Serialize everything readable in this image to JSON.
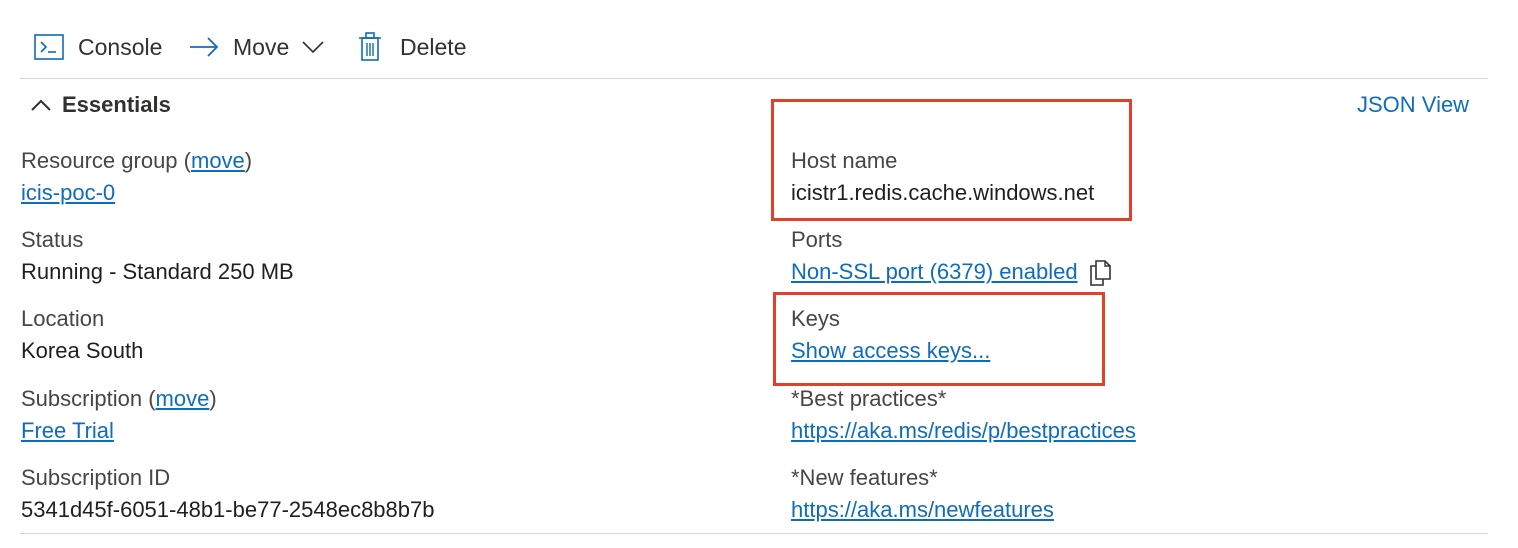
{
  "toolbar": {
    "console_label": "Console",
    "move_label": "Move",
    "delete_label": "Delete",
    "icons": {
      "console": "console-icon",
      "move": "arrow-right-icon",
      "move_dropdown": "chevron-down-icon",
      "delete": "trash-icon"
    }
  },
  "essentials": {
    "title": "Essentials",
    "json_view": "JSON View",
    "left": {
      "resource_group_label": "Resource group",
      "resource_group_move": "move",
      "resource_group_value": "icis-poc-0",
      "status_label": "Status",
      "status_value": "Running - Standard 250 MB",
      "location_label": "Location",
      "location_value": "Korea South",
      "subscription_label": "Subscription",
      "subscription_move": "move",
      "subscription_value": "Free Trial",
      "subscription_id_label": "Subscription ID",
      "subscription_id_value": "5341d45f-6051-48b1-be77-2548ec8b8b7b"
    },
    "right": {
      "host_name_label": "Host name",
      "host_name_value": "icistr1.redis.cache.windows.net",
      "ports_label": "Ports",
      "ports_value": "Non-SSL port (6379) enabled",
      "keys_label": "Keys",
      "keys_value": "Show access keys...",
      "best_practices_label": "*Best practices*",
      "best_practices_value": "https://aka.ms/redis/p/bestpractices",
      "new_features_label": "*New features*",
      "new_features_value": "https://aka.ms/newfeatures"
    }
  },
  "colors": {
    "link": "#0f6cbd",
    "highlight": "#e0412b",
    "text": "#323130",
    "divider": "#d6d6d6"
  }
}
